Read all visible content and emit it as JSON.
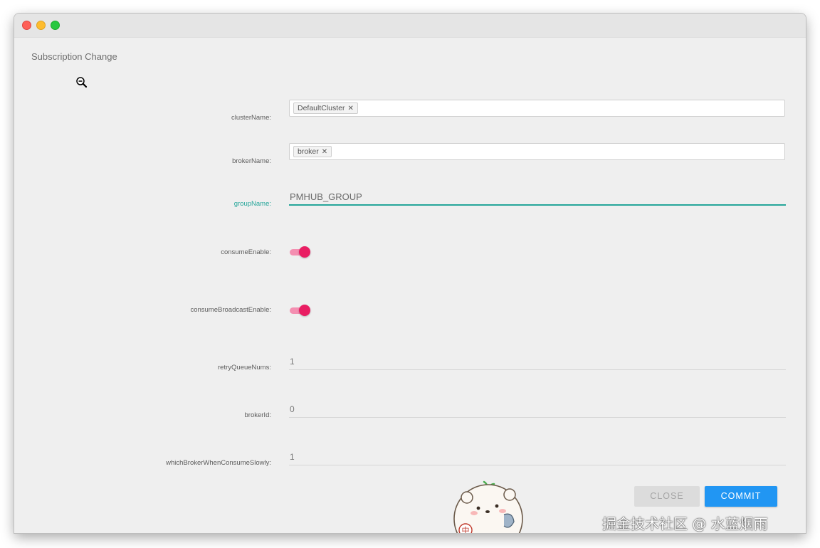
{
  "window": {
    "controls": {
      "close_icon": "close-circle-icon",
      "minimize_icon": "minimize-circle-icon",
      "maximize_icon": "maximize-circle-icon"
    }
  },
  "dialog": {
    "title": "Subscription Change",
    "fields": {
      "clusterName": {
        "label": "clusterName:",
        "chips": [
          "DefaultCluster"
        ]
      },
      "brokerName": {
        "label": "brokerName:",
        "chips": [
          "broker"
        ]
      },
      "groupName": {
        "label": "groupName:",
        "value": "PMHUB_GROUP"
      },
      "consumeEnable": {
        "label": "consumeEnable:",
        "checked": true
      },
      "consumeBroadcastEnable": {
        "label": "consumeBroadcastEnable:",
        "checked": true
      },
      "retryQueueNums": {
        "label": "retryQueueNums:",
        "value": "1"
      },
      "brokerId": {
        "label": "brokerId:",
        "value": "0"
      },
      "whichBrokerWhenConsumeSlowly": {
        "label": "whichBrokerWhenConsumeSlowly:",
        "value": "1"
      }
    },
    "chip_remove_glyph": "✕",
    "buttons": {
      "close": "CLOSE",
      "commit": "COMMIT"
    }
  },
  "colors": {
    "accent": "#26a69a",
    "switch_on": "#e91e63",
    "switch_track": "#f48fb1",
    "commit_button": "#2196f3",
    "close_button": "#dcdcdc"
  },
  "overlay": {
    "sticker_text": "中",
    "watermark": "掘金技术社区 @ 水蓝烟雨"
  }
}
